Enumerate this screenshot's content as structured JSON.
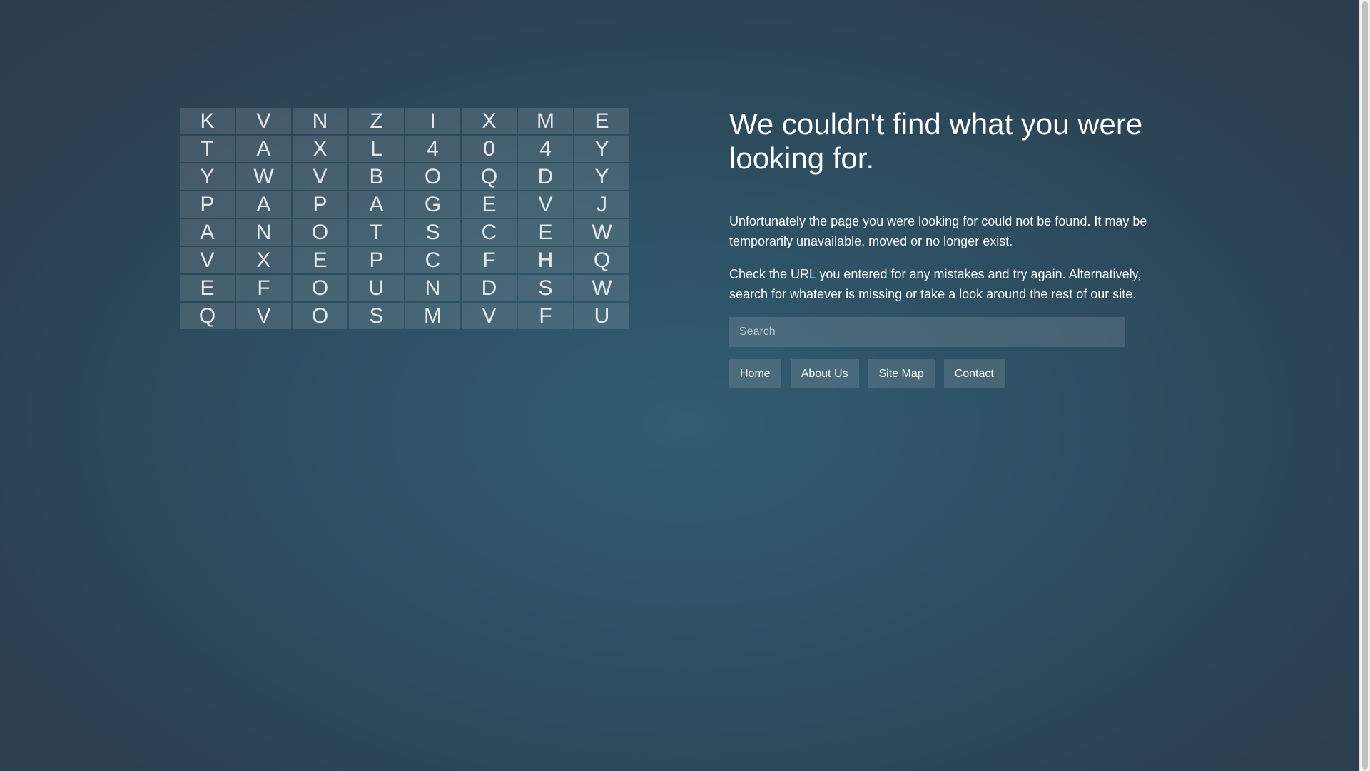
{
  "grid": {
    "rows": [
      [
        "K",
        "V",
        "N",
        "Z",
        "I",
        "X",
        "M",
        "E"
      ],
      [
        "T",
        "A",
        "X",
        "L",
        "4",
        "0",
        "4",
        "Y"
      ],
      [
        "Y",
        "W",
        "V",
        "B",
        "O",
        "Q",
        "D",
        "Y"
      ],
      [
        "P",
        "A",
        "P",
        "A",
        "G",
        "E",
        "V",
        "J"
      ],
      [
        "A",
        "N",
        "O",
        "T",
        "S",
        "C",
        "E",
        "W"
      ],
      [
        "V",
        "X",
        "E",
        "P",
        "C",
        "F",
        "H",
        "Q"
      ],
      [
        "E",
        "F",
        "O",
        "U",
        "N",
        "D",
        "S",
        "W"
      ],
      [
        "Q",
        "V",
        "O",
        "S",
        "M",
        "V",
        "F",
        "U"
      ]
    ]
  },
  "main": {
    "title": "We couldn't find what you were looking for.",
    "paragraph1": "Unfortunately the page you were looking for could not be found. It may be temporarily unavailable, moved or no longer exist.",
    "paragraph2": "Check the URL you entered for any mistakes and try again. Alternatively, search for whatever is missing or take a look around the rest of our site."
  },
  "search": {
    "placeholder": "Search",
    "value": ""
  },
  "nav": {
    "items": [
      {
        "label": "Home"
      },
      {
        "label": "About Us"
      },
      {
        "label": "Site Map"
      },
      {
        "label": "Contact"
      }
    ]
  },
  "colors": {
    "background_center": "#325c70",
    "background_edge": "#2b3b4c",
    "text": "#ffffff"
  }
}
